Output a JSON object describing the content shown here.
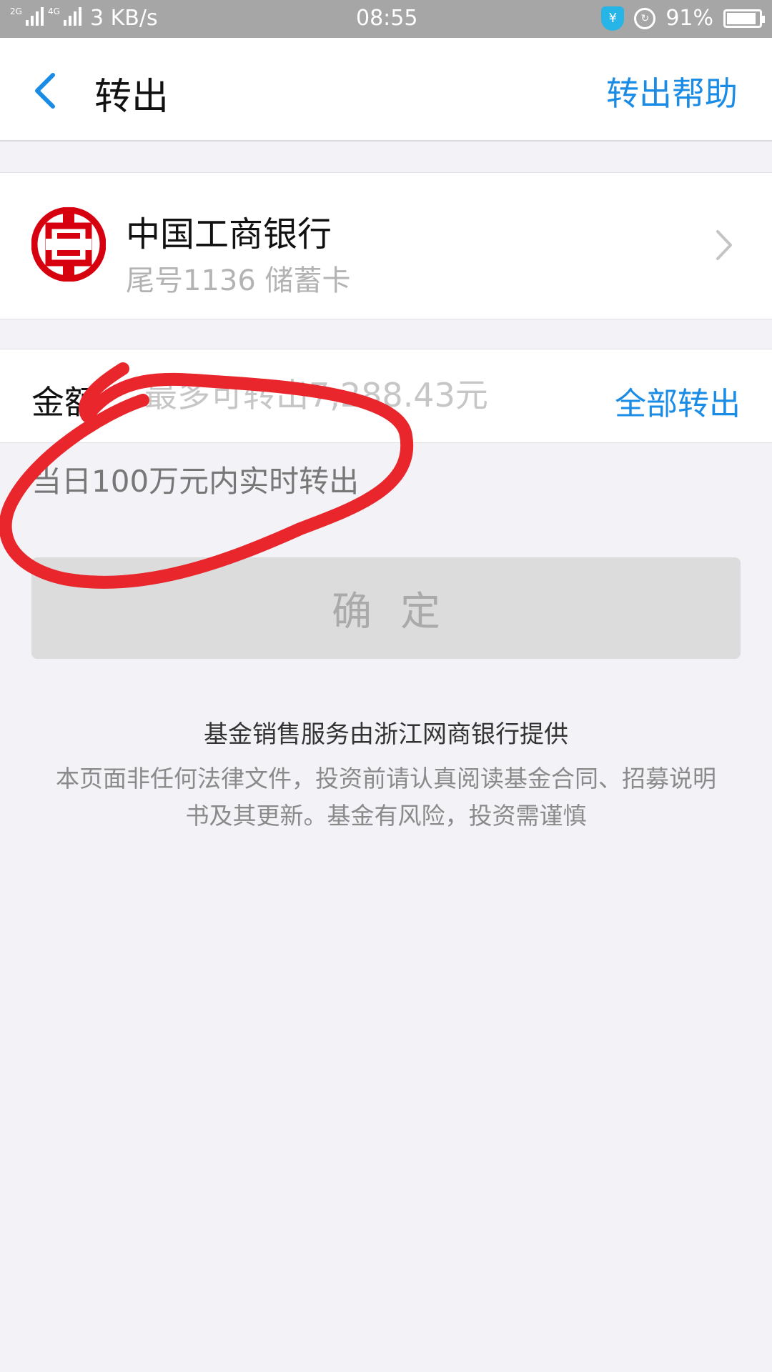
{
  "status_bar": {
    "network_1": "2G",
    "network_2": "4G",
    "speed": "3 KB/s",
    "time": "08:55",
    "battery": "91%",
    "battery_level": 0.91,
    "shield_icon_text": "¥"
  },
  "header": {
    "title": "转出",
    "help_label": "转出帮助"
  },
  "bank": {
    "name": "中国工商银行",
    "card_info": "尾号1136  储蓄卡"
  },
  "amount": {
    "label": "金额",
    "placeholder": "最多可转出7,288.43元",
    "all_out_label": "全部转出"
  },
  "notice": "当日100万元内实时转出",
  "confirm_label": "确定",
  "footer": {
    "title": "基金销售服务由浙江网商银行提供",
    "disclaimer": "本页面非任何法律文件，投资前请认真阅读基金合同、招募说明书及其更新。基金有风险，投资需谨慎"
  },
  "colors": {
    "accent": "#1a8ce6",
    "icbc_red": "#d7000f",
    "annotation_red": "#e8262b"
  }
}
